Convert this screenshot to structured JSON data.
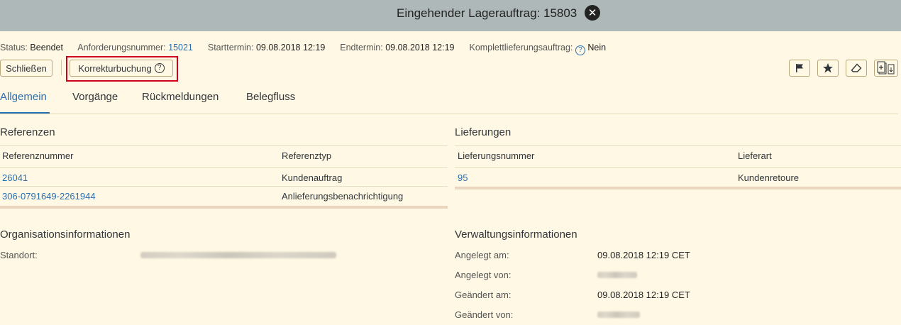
{
  "header": {
    "title": "Eingehender Lagerauftrag: 15803"
  },
  "status_row": {
    "status_label": "Status:",
    "status_value": "Beendet",
    "anforderung_label": "Anforderungsnummer:",
    "anforderung_value": "15021",
    "start_label": "Starttermin:",
    "start_value": "09.08.2018 12:19",
    "end_label": "Endtermin:",
    "end_value": "09.08.2018 12:19",
    "komplett_label": "Komplettlieferungsauftrag:",
    "komplett_value": "Nein"
  },
  "toolbar": {
    "close_label": "Schließen",
    "korrektur_label": "Korrekturbuchung"
  },
  "tabs": [
    {
      "label": "Allgemein",
      "active": true
    },
    {
      "label": "Vorgänge",
      "active": false
    },
    {
      "label": "Rückmeldungen",
      "active": false
    },
    {
      "label": "Belegfluss",
      "active": false
    }
  ],
  "referenzen": {
    "title": "Referenzen",
    "col1": "Referenznummer",
    "col2": "Referenztyp",
    "rows": [
      {
        "nummer": "26041",
        "typ": "Kundenauftrag"
      },
      {
        "nummer": "306-0791649-2261944",
        "typ": "Anlieferungsbenachrichtigung"
      }
    ]
  },
  "lieferungen": {
    "title": "Lieferungen",
    "col1": "Lieferungsnummer",
    "col2": "Lieferart",
    "rows": [
      {
        "nummer": "95",
        "art": "Kundenretoure"
      }
    ]
  },
  "organisation": {
    "title": "Organisationsinformationen",
    "standort_label": "Standort:"
  },
  "verwaltung": {
    "title": "Verwaltungsinformationen",
    "angelegt_am_label": "Angelegt am:",
    "angelegt_am_value": "09.08.2018 12:19 CET",
    "angelegt_von_label": "Angelegt von:",
    "geaendert_am_label": "Geändert am:",
    "geaendert_am_value": "09.08.2018 12:19 CET",
    "geaendert_von_label": "Geändert von:"
  },
  "colors": {
    "background": "#fff8e4",
    "titlebar": "#aeb8b9",
    "link": "#2a6fb0",
    "highlight": "#d0021b"
  },
  "icons": {
    "close": "close-circle-icon",
    "help": "help-circle-icon",
    "flag": "flag-icon",
    "star": "star-icon",
    "eraser": "eraser-icon",
    "add_tile": "add-tile-icon"
  }
}
